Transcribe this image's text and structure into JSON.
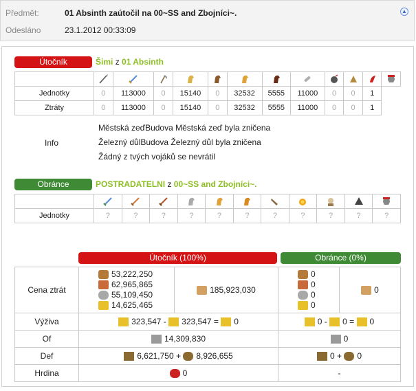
{
  "header": {
    "subject_label": "Předmět:",
    "subject": "01 Absinth zaútočil na 00~SS and Zbojníci~.",
    "sent_label": "Odesláno",
    "sent": "23.1.2012 00:33:09"
  },
  "attacker": {
    "badge": "Útočník",
    "player": "Šimi",
    "z": "z",
    "village": "01 Absinth",
    "icons": [
      "spear-icon",
      "sword-icon",
      "axe-icon",
      "scout-icon",
      "light-cavalry-icon",
      "mounted-archer-icon",
      "heavy-cavalry-icon",
      "ram-icon",
      "catapult-icon",
      "paladin-icon",
      "noble-icon",
      "militia-icon"
    ],
    "rows": [
      {
        "label": "Jednotky",
        "values": [
          "0",
          "113000",
          "0",
          "15140",
          "0",
          "32532",
          "5555",
          "11000",
          "0",
          "0",
          "1"
        ]
      },
      {
        "label": "Ztráty",
        "values": [
          "0",
          "113000",
          "0",
          "15140",
          "0",
          "32532",
          "5555",
          "11000",
          "0",
          "0",
          "1"
        ]
      }
    ],
    "info_label": "Info",
    "info": [
      "Městská zeďBudova Městská zeď byla zničena",
      "Železný důlBudova Železný důl byla zničena",
      "Žádný z tvých vojáků se nevrátil"
    ]
  },
  "defender": {
    "badge": "Obránce",
    "player": "POSTRADATELNI",
    "z": "z",
    "village": "00~SS and Zbojníci~.",
    "row_label": "Jednotky",
    "values": [
      "?",
      "?",
      "?",
      "?",
      "?",
      "?",
      "?",
      "?",
      "?",
      "?",
      "?",
      "?",
      "?"
    ]
  },
  "summary": {
    "att_header": "Útočník (100%)",
    "def_header": "Obránce (0%)",
    "rows": {
      "cost_label": "Cena ztrát",
      "att_res": [
        "53,222,250",
        "62,965,865",
        "55,109,450",
        "14,625,465"
      ],
      "att_total": "185,923,030",
      "def_res": [
        "0",
        "0",
        "0",
        "0"
      ],
      "def_total": "0",
      "food_label": "Výživa",
      "att_food": "323,547 - ",
      "att_food2": "323,547 = ",
      "att_food3": "0",
      "def_food": "0 - ",
      "def_food2": "0 = ",
      "def_food3": "0",
      "of_label": "Of",
      "att_of": "14,309,830",
      "def_of": "0",
      "def_label": "Def",
      "att_def1": "6,621,750 + ",
      "att_def2": "8,926,655",
      "def_def1": "0 + ",
      "def_def2": "0",
      "hero_label": "Hrdina",
      "att_hero": "0",
      "def_hero": "-"
    }
  }
}
